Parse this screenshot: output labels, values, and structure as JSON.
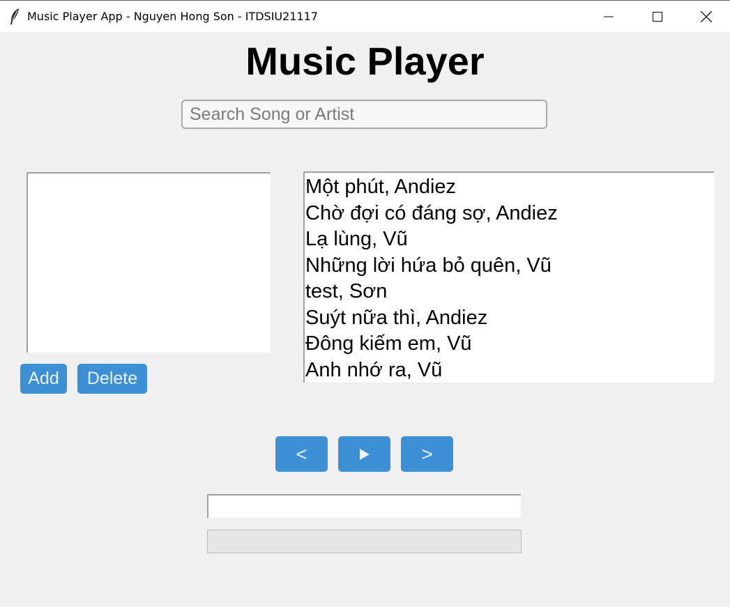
{
  "window": {
    "title": "Music Player App - Nguyen Hong Son - ITDSIU21117",
    "icon": "feather-icon",
    "controls": [
      "minimize-icon",
      "maximize-icon",
      "close-icon"
    ]
  },
  "app": {
    "heading": "Music Player"
  },
  "search": {
    "placeholder": "Search Song or Artist",
    "value": ""
  },
  "playlist": {
    "items": [],
    "add_label": "Add",
    "delete_label": "Delete"
  },
  "songs": [
    "Một phút, Andiez",
    "Chờ đợi có đáng sợ, Andiez",
    "Lạ lùng, Vũ",
    "Những lời hứa bỏ quên, Vũ",
    "test, Sơn",
    "Suýt nữa thì, Andiez",
    "Đông kiếm em, Vũ",
    "Anh nhớ ra, Vũ"
  ],
  "controls": {
    "prev_label": "<",
    "play_icon": "play-icon",
    "next_label": ">"
  },
  "now_playing": {
    "text": ""
  },
  "progress": {
    "fraction": 0
  },
  "colors": {
    "accent": "#3d8fd6",
    "button_text": "#e9f2fb",
    "background": "#f0f0f0"
  }
}
